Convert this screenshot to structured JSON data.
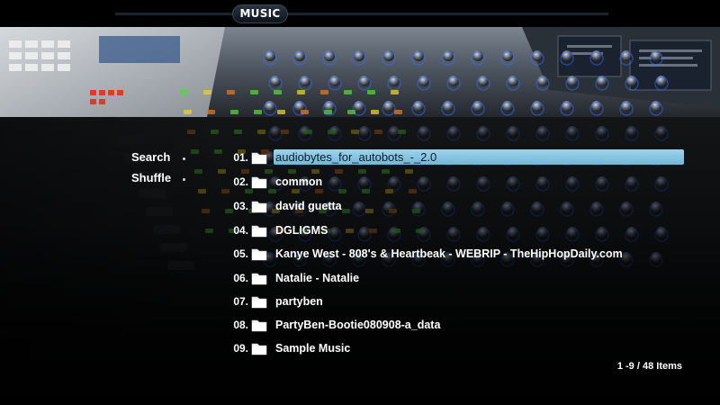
{
  "header": {
    "title": "MUSIC"
  },
  "sidebar": {
    "items": [
      {
        "label": "Search"
      },
      {
        "label": "Shuffle"
      }
    ]
  },
  "list": {
    "items": [
      {
        "number": "01.",
        "label": "audiobytes_for_autobots_-_2.0",
        "icon": "folder-icon",
        "selected": true
      },
      {
        "number": "02.",
        "label": "common",
        "icon": "folder-icon"
      },
      {
        "number": "03.",
        "label": "david guetta",
        "icon": "folder-icon"
      },
      {
        "number": "04.",
        "label": "DGLIGMS",
        "icon": "folder-icon"
      },
      {
        "number": "05.",
        "label": "Kanye West - 808's & Heartbeak - WEBRIP - TheHipHopDaily.com",
        "icon": "folder-icon"
      },
      {
        "number": "06.",
        "label": "Natalie - Natalie",
        "icon": "folder-icon"
      },
      {
        "number": "07.",
        "label": "partyben",
        "icon": "folder-icon"
      },
      {
        "number": "08.",
        "label": "PartyBen-Bootie080908-a_data",
        "icon": "folder-icon"
      },
      {
        "number": "09.",
        "label": "Sample Music",
        "icon": "folder-icon"
      }
    ],
    "count_text": "1 -9 / 48 Items"
  },
  "colors": {
    "selection": "#8cc8e2",
    "text": "#ffffff",
    "background": "#07080a"
  },
  "background": {
    "description_icon": "mixing-console-photo"
  }
}
